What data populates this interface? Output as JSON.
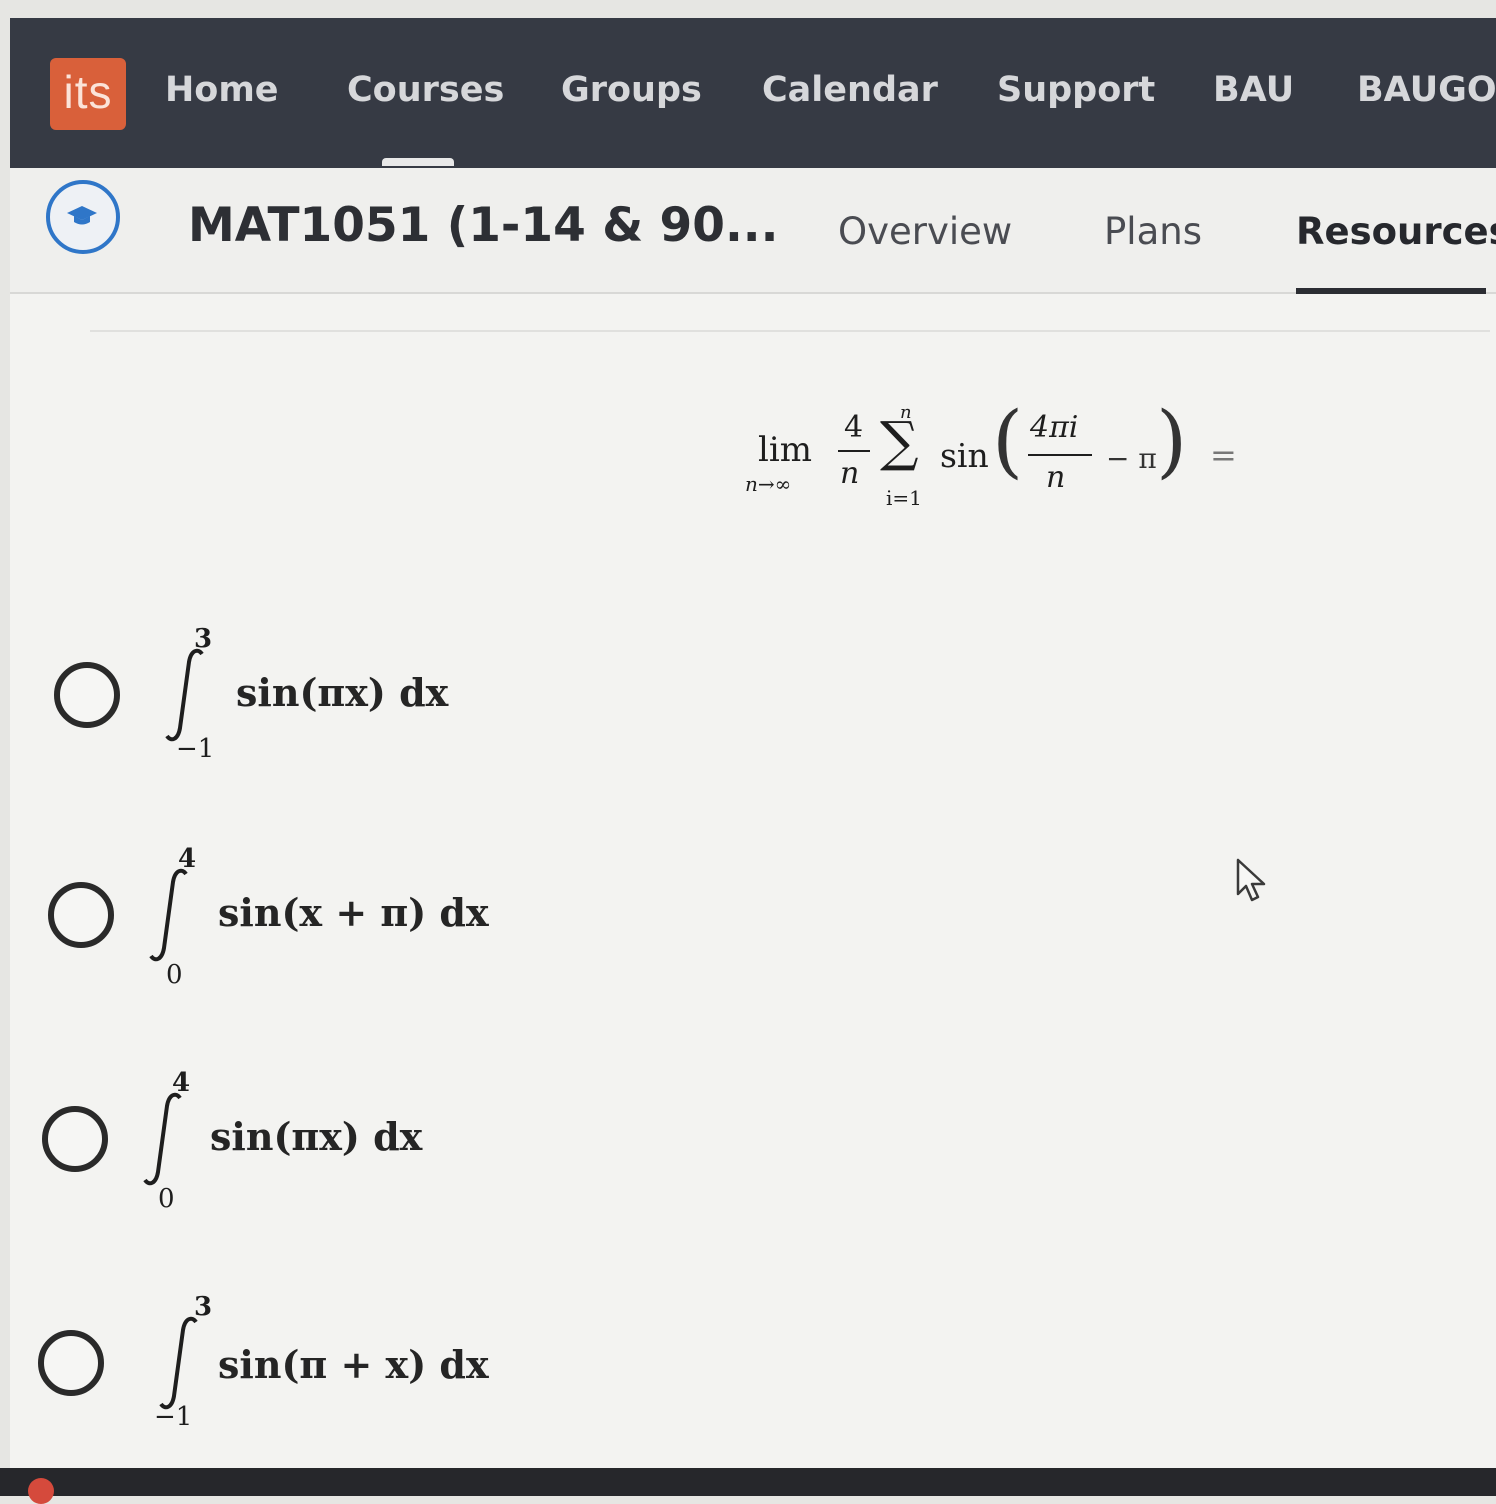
{
  "nav": {
    "logo": "its",
    "items": [
      "Home",
      "Courses",
      "Groups",
      "Calendar",
      "Support",
      "BAU",
      "BAUGO"
    ]
  },
  "course": {
    "title": "MAT1051 (1-14 & 90...",
    "tabs": [
      "Overview",
      "Plans",
      "Resources"
    ],
    "active_tab": "Resources"
  },
  "question": {
    "lim": "lim",
    "lim_sub": "n→∞",
    "coef_num": "4",
    "coef_den": "n",
    "sum_upper": "n",
    "sum_lower": "i=1",
    "func": "sin",
    "inner_num": "4πi",
    "inner_den": "n",
    "inner_tail": "− π",
    "equals": "="
  },
  "options": [
    {
      "upper": "3",
      "lower": "−1",
      "integrand": "sin(πx) dx"
    },
    {
      "upper": "4",
      "lower": "0",
      "integrand": "sin(x + π) dx"
    },
    {
      "upper": "4",
      "lower": "0",
      "integrand": "sin(πx) dx"
    },
    {
      "upper": "3",
      "lower": "−1",
      "integrand": "sin(π + x) dx"
    }
  ]
}
